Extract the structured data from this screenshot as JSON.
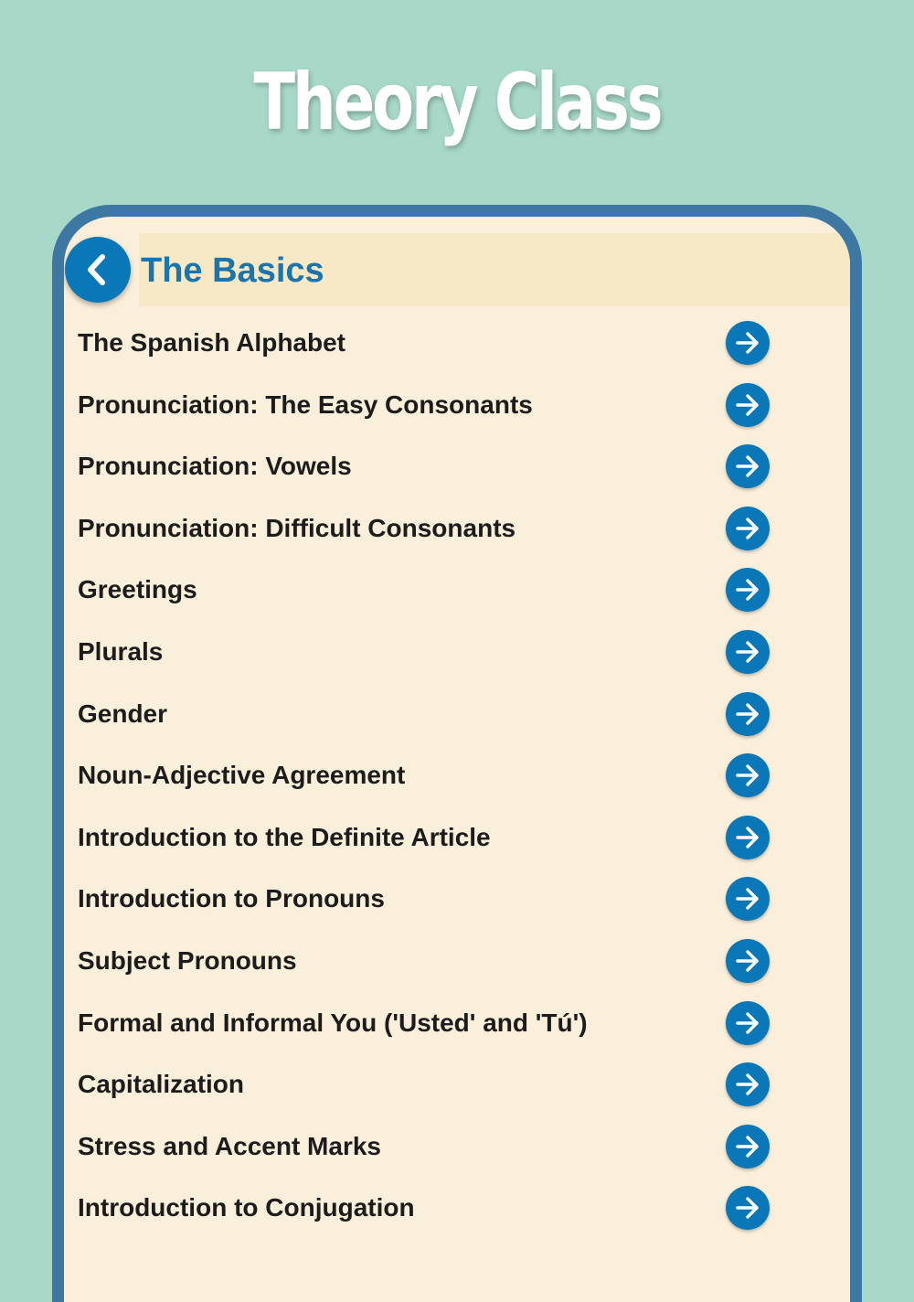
{
  "promo": {
    "title": "Theory Class"
  },
  "header": {
    "back_icon": "chevron-left-icon",
    "title": "The Basics"
  },
  "colors": {
    "background": "#a7d8c8",
    "frame": "#3d78a3",
    "screen": "#faefda",
    "header_band": "#f8e9c6",
    "accent": "#0a78b8",
    "title_text": "#1a74ad"
  },
  "lessons": [
    {
      "label": "The Spanish Alphabet",
      "icon": "arrow-right-icon"
    },
    {
      "label": "Pronunciation: The Easy Consonants",
      "icon": "arrow-right-icon"
    },
    {
      "label": "Pronunciation: Vowels",
      "icon": "arrow-right-icon"
    },
    {
      "label": "Pronunciation: Difficult Consonants",
      "icon": "arrow-right-icon"
    },
    {
      "label": "Greetings",
      "icon": "arrow-right-icon"
    },
    {
      "label": "Plurals",
      "icon": "arrow-right-icon"
    },
    {
      "label": "Gender",
      "icon": "arrow-right-icon"
    },
    {
      "label": "Noun-Adjective Agreement",
      "icon": "arrow-right-icon"
    },
    {
      "label": "Introduction to the Definite Article",
      "icon": "arrow-right-icon"
    },
    {
      "label": "Introduction to Pronouns",
      "icon": "arrow-right-icon"
    },
    {
      "label": "Subject Pronouns",
      "icon": "arrow-right-icon"
    },
    {
      "label": "Formal and Informal You ('Usted' and 'Tú')",
      "icon": "arrow-right-icon"
    },
    {
      "label": "Capitalization",
      "icon": "arrow-right-icon"
    },
    {
      "label": "Stress and Accent Marks",
      "icon": "arrow-right-icon"
    },
    {
      "label": "Introduction to Conjugation",
      "icon": "arrow-right-icon"
    }
  ]
}
